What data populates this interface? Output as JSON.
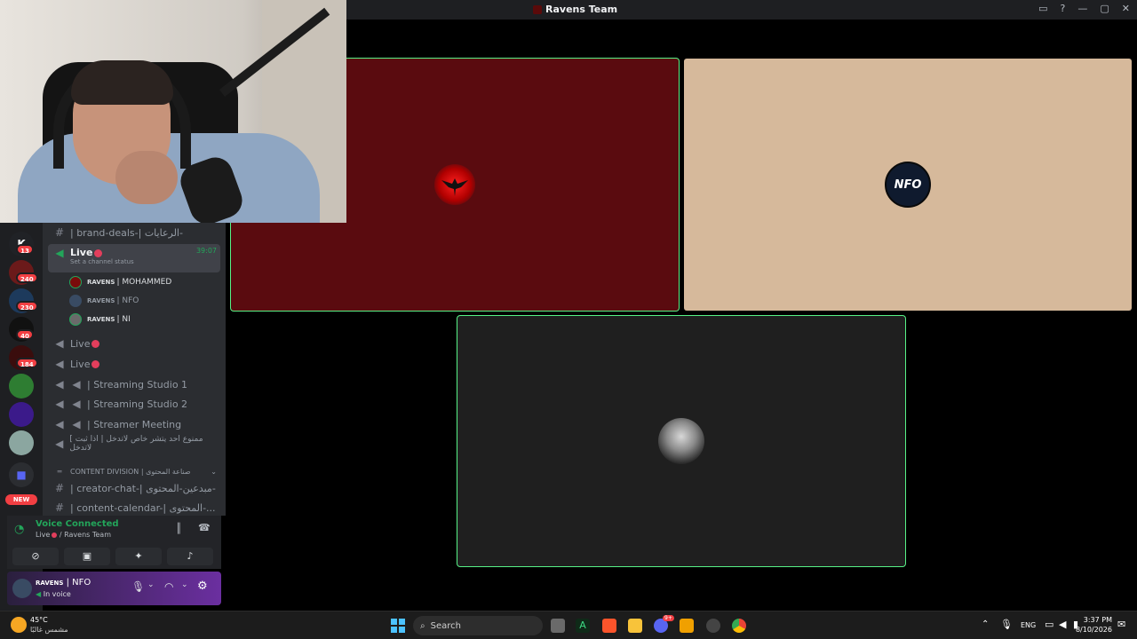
{
  "window": {
    "title": "Ravens Team"
  },
  "rail": {
    "badges": [
      "13",
      "240",
      "230",
      "40",
      "184"
    ],
    "new_label": "NEW"
  },
  "channels": [
    {
      "type": "text",
      "locked": true,
      "label": "| brand-deals-| الرعايات-"
    },
    {
      "type": "voice",
      "label": "Live",
      "status": "Set a channel status",
      "timer": "39:07"
    },
    {
      "type": "voice",
      "label": "Live"
    },
    {
      "type": "voice",
      "label": "Live"
    },
    {
      "type": "voice",
      "label": "| Streaming Studio 1"
    },
    {
      "type": "voice",
      "label": "| Streaming Studio 2"
    },
    {
      "type": "voice",
      "label": "| Streamer Meeting"
    },
    {
      "type": "voice",
      "label": "[ ممنوع احد يتشر خاص لاتدخل | اذا ثبت لاتدخل"
    }
  ],
  "voice_users": [
    {
      "tag": "RAVENS",
      "name": "| MOHAMMED"
    },
    {
      "tag": "RAVENS",
      "name": "| NFO"
    },
    {
      "tag": "RAVENS",
      "name": "| NI"
    }
  ],
  "category": {
    "label": "CONTENT DIVISION | صناعة المحتوى"
  },
  "category_channels": [
    {
      "label": "| creator-chat-| مبدعين-المحتوى-"
    },
    {
      "label": "| content-calendar-| المحتوى-..."
    }
  ],
  "voice_panel": {
    "status": "Voice Connected",
    "location_live": "Live",
    "location_server": "/ Ravens Team"
  },
  "user_panel": {
    "tag": "RAVENS",
    "name": "| NFO",
    "status": "In voice"
  },
  "taskbar": {
    "weather_temp": "45°C",
    "weather_desc": "مشمس غالبًا",
    "search_placeholder": "Search",
    "lang": "ENG",
    "time": "3:37 PM",
    "date": "8/10/2026",
    "discord_badge": "9+"
  },
  "colors": {
    "tile_red": "#5a0b0f",
    "tile_beige": "#d6b99b",
    "tile_dark": "#1f1f1f",
    "speaking": "#57f287",
    "live_dot": "#e33e5c",
    "voice_green": "#23a55a"
  }
}
